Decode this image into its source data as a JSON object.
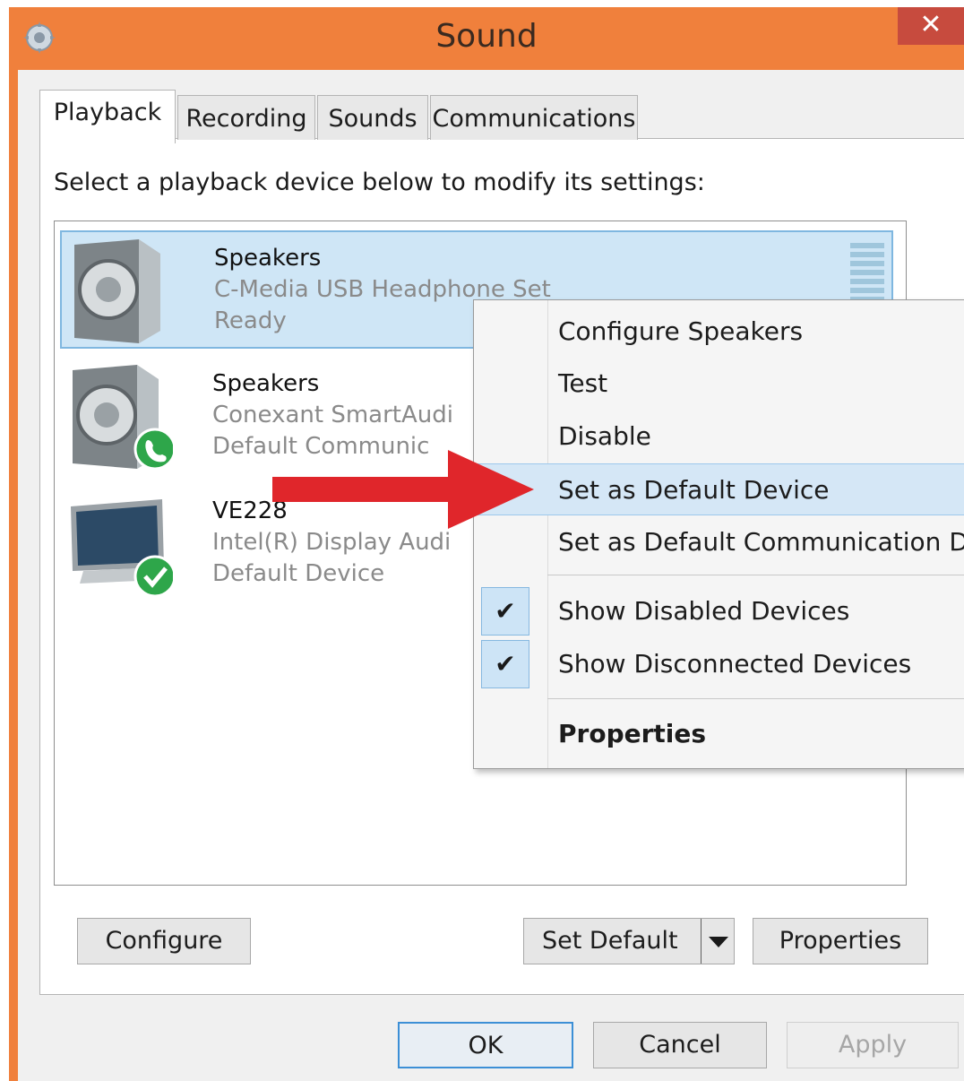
{
  "window": {
    "title": "Sound",
    "close_label": "✕",
    "title_bar_color": "#f0803c"
  },
  "tabs": [
    {
      "label": "Playback",
      "active": true
    },
    {
      "label": "Recording",
      "active": false
    },
    {
      "label": "Sounds",
      "active": false
    },
    {
      "label": "Communications",
      "active": false
    }
  ],
  "instruction": "Select a playback device below to modify its settings:",
  "devices": [
    {
      "name": "Speakers",
      "line2": "C-Media USB Headphone Set",
      "line3": "Ready",
      "icon": "speaker-icon",
      "selected": true
    },
    {
      "name": "Speakers",
      "line2": "Conexant SmartAudi",
      "line3": "Default Communic",
      "icon": "speaker-icon",
      "badge": "phone-badge-icon"
    },
    {
      "name": "VE228",
      "line2": "Intel(R) Display Audi",
      "line3": "Default Device",
      "icon": "monitor-icon",
      "badge": "checkmark-badge-icon"
    }
  ],
  "context_menu": {
    "items": [
      {
        "label": "Configure Speakers"
      },
      {
        "label": "Test"
      },
      {
        "label": "Disable"
      },
      {
        "label": "Set as Default Device",
        "highlighted": true
      },
      {
        "label": "Set as Default Communication D"
      },
      {
        "label": "Show Disabled Devices",
        "checked": true,
        "check_glyph": "✔"
      },
      {
        "label": "Show Disconnected Devices",
        "checked": true,
        "check_glyph": "✔"
      },
      {
        "label": "Properties",
        "bold": true
      }
    ]
  },
  "buttons": {
    "configure": "Configure",
    "set_default": "Set Default",
    "properties": "Properties",
    "ok": "OK",
    "cancel": "Cancel",
    "apply": "Apply"
  },
  "annotation": {
    "arrow_color": "#e0262b"
  }
}
